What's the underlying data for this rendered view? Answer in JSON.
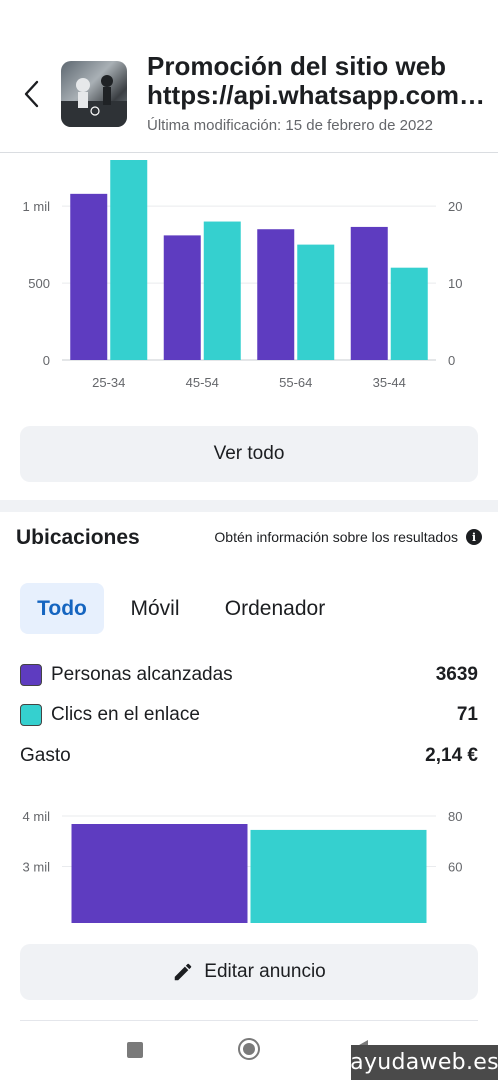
{
  "header": {
    "title_line1": "Promoción del sitio web",
    "title_line2": "https://api.whatsapp.com/send",
    "subtitle": "Última modificación: 15 de febrero de 2022"
  },
  "colors": {
    "purple": "#5e3cc0",
    "teal": "#35d0cf",
    "accent": "#1565c0"
  },
  "age_chart": {
    "left_ticks": [
      "1 mil",
      "500",
      "0"
    ],
    "right_ticks": [
      "20",
      "10",
      "0"
    ]
  },
  "ver_todo_label": "Ver todo",
  "placements": {
    "title": "Ubicaciones",
    "info_link": "Obtén información sobre los resultados",
    "tabs": [
      {
        "label": "Todo",
        "active": true
      },
      {
        "label": "Móvil",
        "active": false
      },
      {
        "label": "Ordenador",
        "active": false
      }
    ],
    "metrics": [
      {
        "label": "Personas alcanzadas",
        "value": "3639",
        "color": "purple"
      },
      {
        "label": "Clics en el enlace",
        "value": "71",
        "color": "teal"
      },
      {
        "label": "Gasto",
        "value": "2,14 €"
      }
    ]
  },
  "placement_chart": {
    "left_ticks": [
      "4 mil",
      "3 mil"
    ],
    "right_ticks": [
      "80",
      "60"
    ]
  },
  "chart_data": [
    {
      "type": "bar",
      "categories": [
        "25-34",
        "45-54",
        "55-64",
        "35-44"
      ],
      "series": [
        {
          "values": [
            1080,
            810,
            850,
            865
          ],
          "axis": "left",
          "color": "#5e3cc0"
        },
        {
          "values": [
            26,
            18,
            15,
            12
          ],
          "axis": "right",
          "color": "#35d0cf"
        }
      ],
      "ylim_left": [
        0,
        1300
      ],
      "ylim_right": [
        0,
        26
      ],
      "grid": true
    },
    {
      "type": "bar",
      "categories": [
        "Todo"
      ],
      "series": [
        {
          "values": [
            3639
          ],
          "axis": "left",
          "color": "#5e3cc0"
        },
        {
          "values": [
            71
          ],
          "axis": "right",
          "color": "#35d0cf"
        }
      ],
      "ylim_left": [
        2150,
        4000
      ],
      "ylim_right": [
        43,
        80
      ],
      "grid": true
    }
  ],
  "edit_button_label": "Editar anuncio",
  "icons": {
    "back": "chevron-left-icon",
    "edit": "pencil-icon",
    "info": "info-icon"
  },
  "watermark": "ayudaweb.es"
}
